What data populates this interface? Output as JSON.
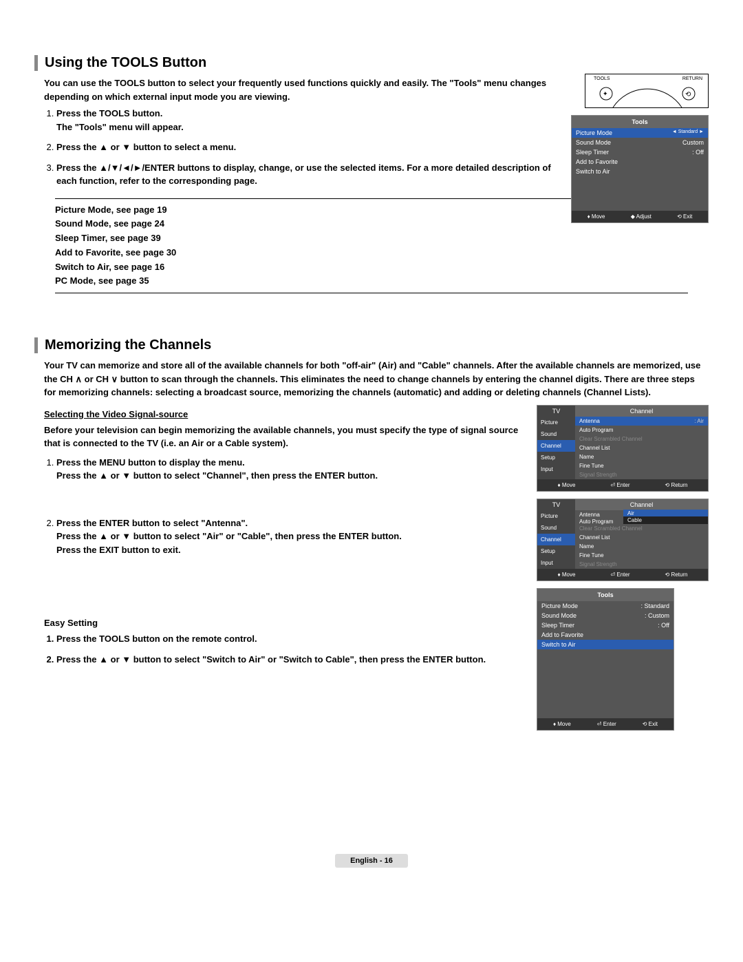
{
  "section1": {
    "title": "Using the TOOLS Button",
    "intro": "You can use the TOOLS button to select your frequently used functions quickly and easily. The \"Tools\" menu changes depending on which external input mode you are viewing.",
    "remote": {
      "tools": "TOOLS",
      "return": "RETURN"
    },
    "steps": [
      {
        "l1": "Press the TOOLS button.",
        "l2": "The \"Tools\" menu will appear."
      },
      {
        "l1": "Press the ▲ or ▼ button to select a menu."
      },
      {
        "l1": "Press the ▲/▼/◄/►/ENTER buttons to display, change, or use the selected items. For a more detailed description of each function, refer to the corresponding page."
      }
    ],
    "refs": [
      "Picture Mode, see page 19",
      "Sound Mode, see page 24",
      "Sleep Timer, see page 39",
      "Add to Favorite, see page 30",
      "Switch to Air, see page 16",
      "PC Mode, see page 35"
    ]
  },
  "tools_panel": {
    "hdr": "Tools",
    "rows": [
      {
        "k": "Picture Mode",
        "v": "Standard"
      },
      {
        "k": "Sound Mode",
        "v": "Custom"
      },
      {
        "k": "Sleep Timer",
        "v": "Off"
      },
      {
        "k": "Add to Favorite",
        "v": ""
      },
      {
        "k": "Switch to Air",
        "v": ""
      }
    ],
    "bot": {
      "move": "Move",
      "adjust": "Adjust",
      "exit": "Exit"
    }
  },
  "section2": {
    "title": "Memorizing the Channels",
    "intro": "Your TV can memorize and store all of the available channels for both \"off-air\" (Air) and \"Cable\" channels. After the available channels are memorized, use the CH ∧ or CH ∨ button to scan through the channels. This eliminates the need to change channels by entering the channel digits. There are three steps for memorizing channels: selecting a broadcast source, memorizing the channels (automatic) and adding or deleting channels (Channel Lists).",
    "sub1": "Selecting the Video Signal-source",
    "para1": "Before your television can begin memorizing the available channels, you must specify the type of signal source that is connected to the TV (i.e. an Air or a Cable system).",
    "steps1": [
      {
        "l1": "Press the MENU button to display the menu.",
        "l2": "Press the ▲ or ▼ button to select \"Channel\", then press the ENTER button."
      },
      {
        "l1": "Press the ENTER button to select \"Antenna\".",
        "l2": "Press the ▲ or ▼ button to select \"Air\" or \"Cable\", then press the ENTER button.",
        "l3": "Press the EXIT button to exit."
      }
    ],
    "sub2": "Easy Setting",
    "steps2": [
      {
        "l1": "Press the TOOLS button on the remote control."
      },
      {
        "l1": "Press the ▲ or ▼ button to select \"Switch to Air\" or \"Switch to Cable\", then press the ENTER button."
      }
    ]
  },
  "channel_panel1": {
    "tv": "TV",
    "ch": "Channel",
    "side": [
      "Picture",
      "Sound",
      "Channel",
      "Setup",
      "Input"
    ],
    "rows": [
      {
        "k": "Antenna",
        "v": ": Air",
        "sel": true
      },
      {
        "k": "Auto Program",
        "v": ""
      },
      {
        "k": "Clear Scrambled Channel",
        "v": "",
        "dim": true
      },
      {
        "k": "Channel List",
        "v": ""
      },
      {
        "k": "Name",
        "v": ""
      },
      {
        "k": "Fine Tune",
        "v": ""
      },
      {
        "k": "Signal Strength",
        "v": "",
        "dim": true
      }
    ],
    "bot": {
      "move": "Move",
      "enter": "Enter",
      "ret": "Return"
    }
  },
  "channel_panel2": {
    "tv": "TV",
    "ch": "Channel",
    "side": [
      "Picture",
      "Sound",
      "Channel",
      "Setup",
      "Input"
    ],
    "rows": [
      {
        "k": "Antenna",
        "v": ""
      },
      {
        "k": "Auto Program",
        "v": ""
      },
      {
        "k": "Clear Scrambled Channel",
        "v": "",
        "dim": true
      },
      {
        "k": "Channel List",
        "v": ""
      },
      {
        "k": "Name",
        "v": ""
      },
      {
        "k": "Fine Tune",
        "v": ""
      },
      {
        "k": "Signal Strength",
        "v": "",
        "dim": true
      }
    ],
    "opts": [
      "Air",
      "Cable"
    ],
    "bot": {
      "move": "Move",
      "enter": "Enter",
      "ret": "Return"
    }
  },
  "tools_panel2": {
    "hdr": "Tools",
    "rows": [
      {
        "k": "Picture Mode",
        "v": "Standard"
      },
      {
        "k": "Sound Mode",
        "v": "Custom"
      },
      {
        "k": "Sleep Timer",
        "v": "Off"
      },
      {
        "k": "Add to Favorite",
        "v": ""
      },
      {
        "k": "Switch to Air",
        "v": ""
      }
    ],
    "bot": {
      "move": "Move",
      "enter": "Enter",
      "exit": "Exit"
    }
  },
  "footer": "English - 16"
}
